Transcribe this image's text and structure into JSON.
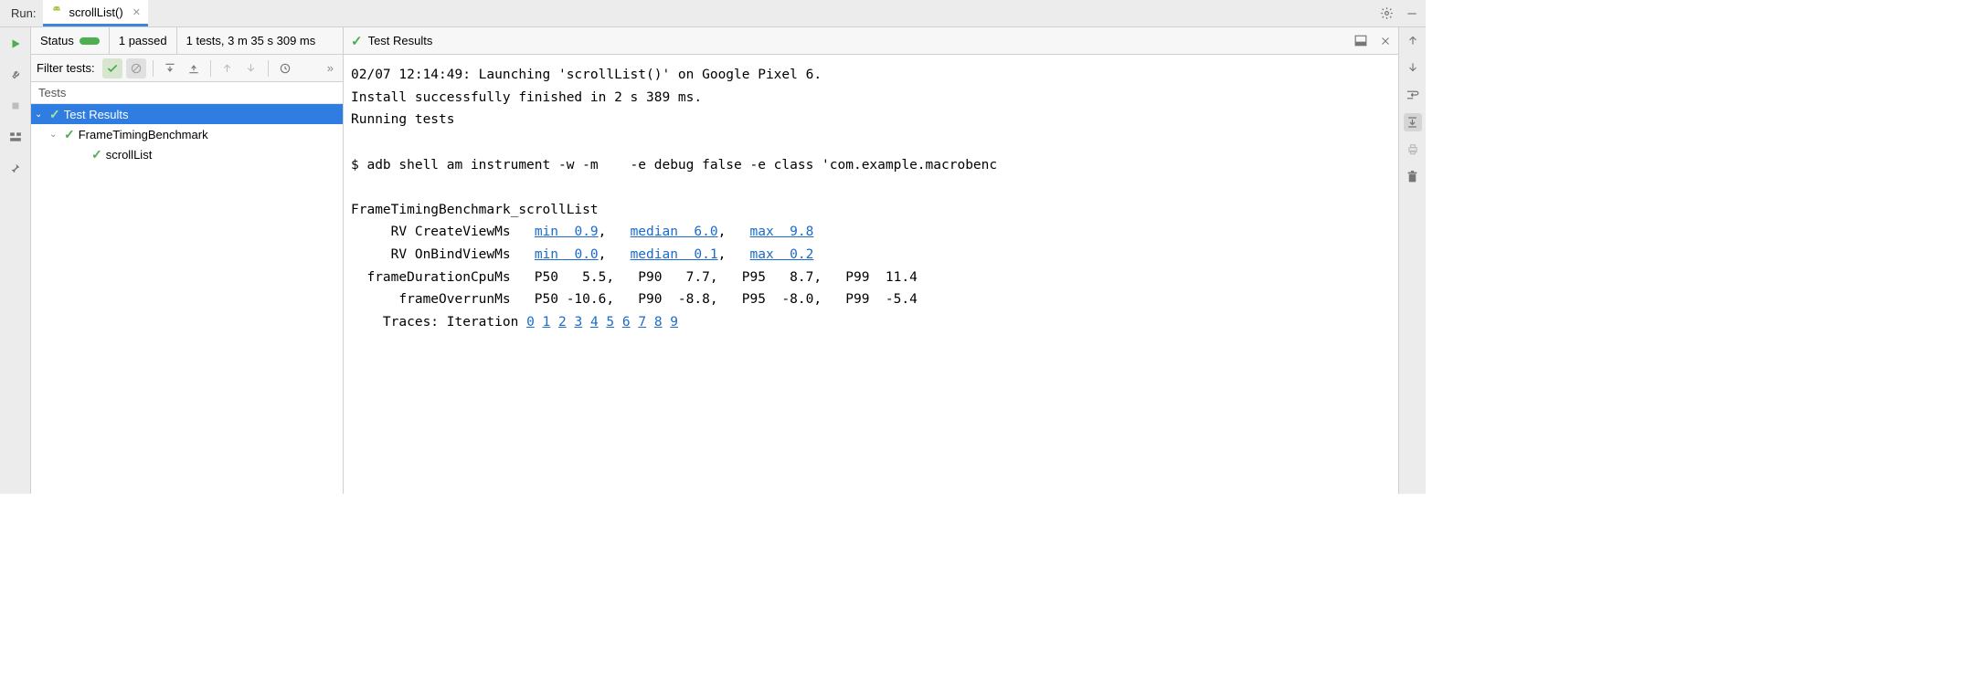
{
  "tabbar": {
    "run_label": "Run:",
    "tab_name": "scrollList()"
  },
  "status": {
    "label": "Status",
    "passed": "1 passed",
    "summary": "1 tests, 3 m 35 s 309 ms"
  },
  "filter": {
    "label": "Filter tests:"
  },
  "tests_header": "Tests",
  "tree": {
    "root": "Test Results",
    "suite": "FrameTimingBenchmark",
    "test": "scrollList"
  },
  "crumb": {
    "label": "Test Results"
  },
  "console": {
    "launch": "02/07 12:14:49: Launching 'scrollList()' on Google Pixel 6.",
    "install": "Install successfully finished in 2 s 389 ms.",
    "running": "Running tests",
    "cmd": "$ adb shell am instrument -w -m    -e debug false -e class 'com.example.macrobenc",
    "bench_title": "FrameTimingBenchmark_scrollList",
    "row1_label": "RV CreateViewMs",
    "row1_min": "min  0.9",
    "row1_med": "median  6.0",
    "row1_max": "max  9.8",
    "row2_label": "RV OnBindViewMs",
    "row2_min": "min  0.0",
    "row2_med": "median  0.1",
    "row2_max": "max  0.2",
    "row3": "  frameDurationCpuMs   P50   5.5,   P90   7.7,   P95   8.7,   P99  11.4",
    "row4": "      frameOverrunMs   P50 -10.6,   P90  -8.8,   P95  -8.0,   P99  -5.4",
    "traces_label": "Traces: Iteration",
    "iters": [
      "0",
      "1",
      "2",
      "3",
      "4",
      "5",
      "6",
      "7",
      "8",
      "9"
    ]
  }
}
